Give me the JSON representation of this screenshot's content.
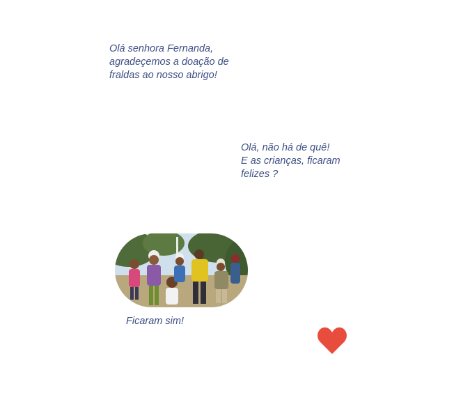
{
  "chat": {
    "messages": [
      {
        "text": "Olá senhora Fernanda,\nagradeçemos a doação de\nfraldas ao nosso abrigo!"
      },
      {
        "text": "Olá, não há de quê!\nE as crianças, ficaram\nfelizes ?"
      },
      {
        "text": "Ficaram sim!"
      }
    ],
    "photo": {
      "icon": "children-group-photo"
    },
    "reaction": {
      "icon": "heart-icon",
      "color": "#e84c3d"
    }
  },
  "colors": {
    "text": "#3e4f84",
    "background": "#ffffff",
    "heart": "#e84c3d"
  }
}
